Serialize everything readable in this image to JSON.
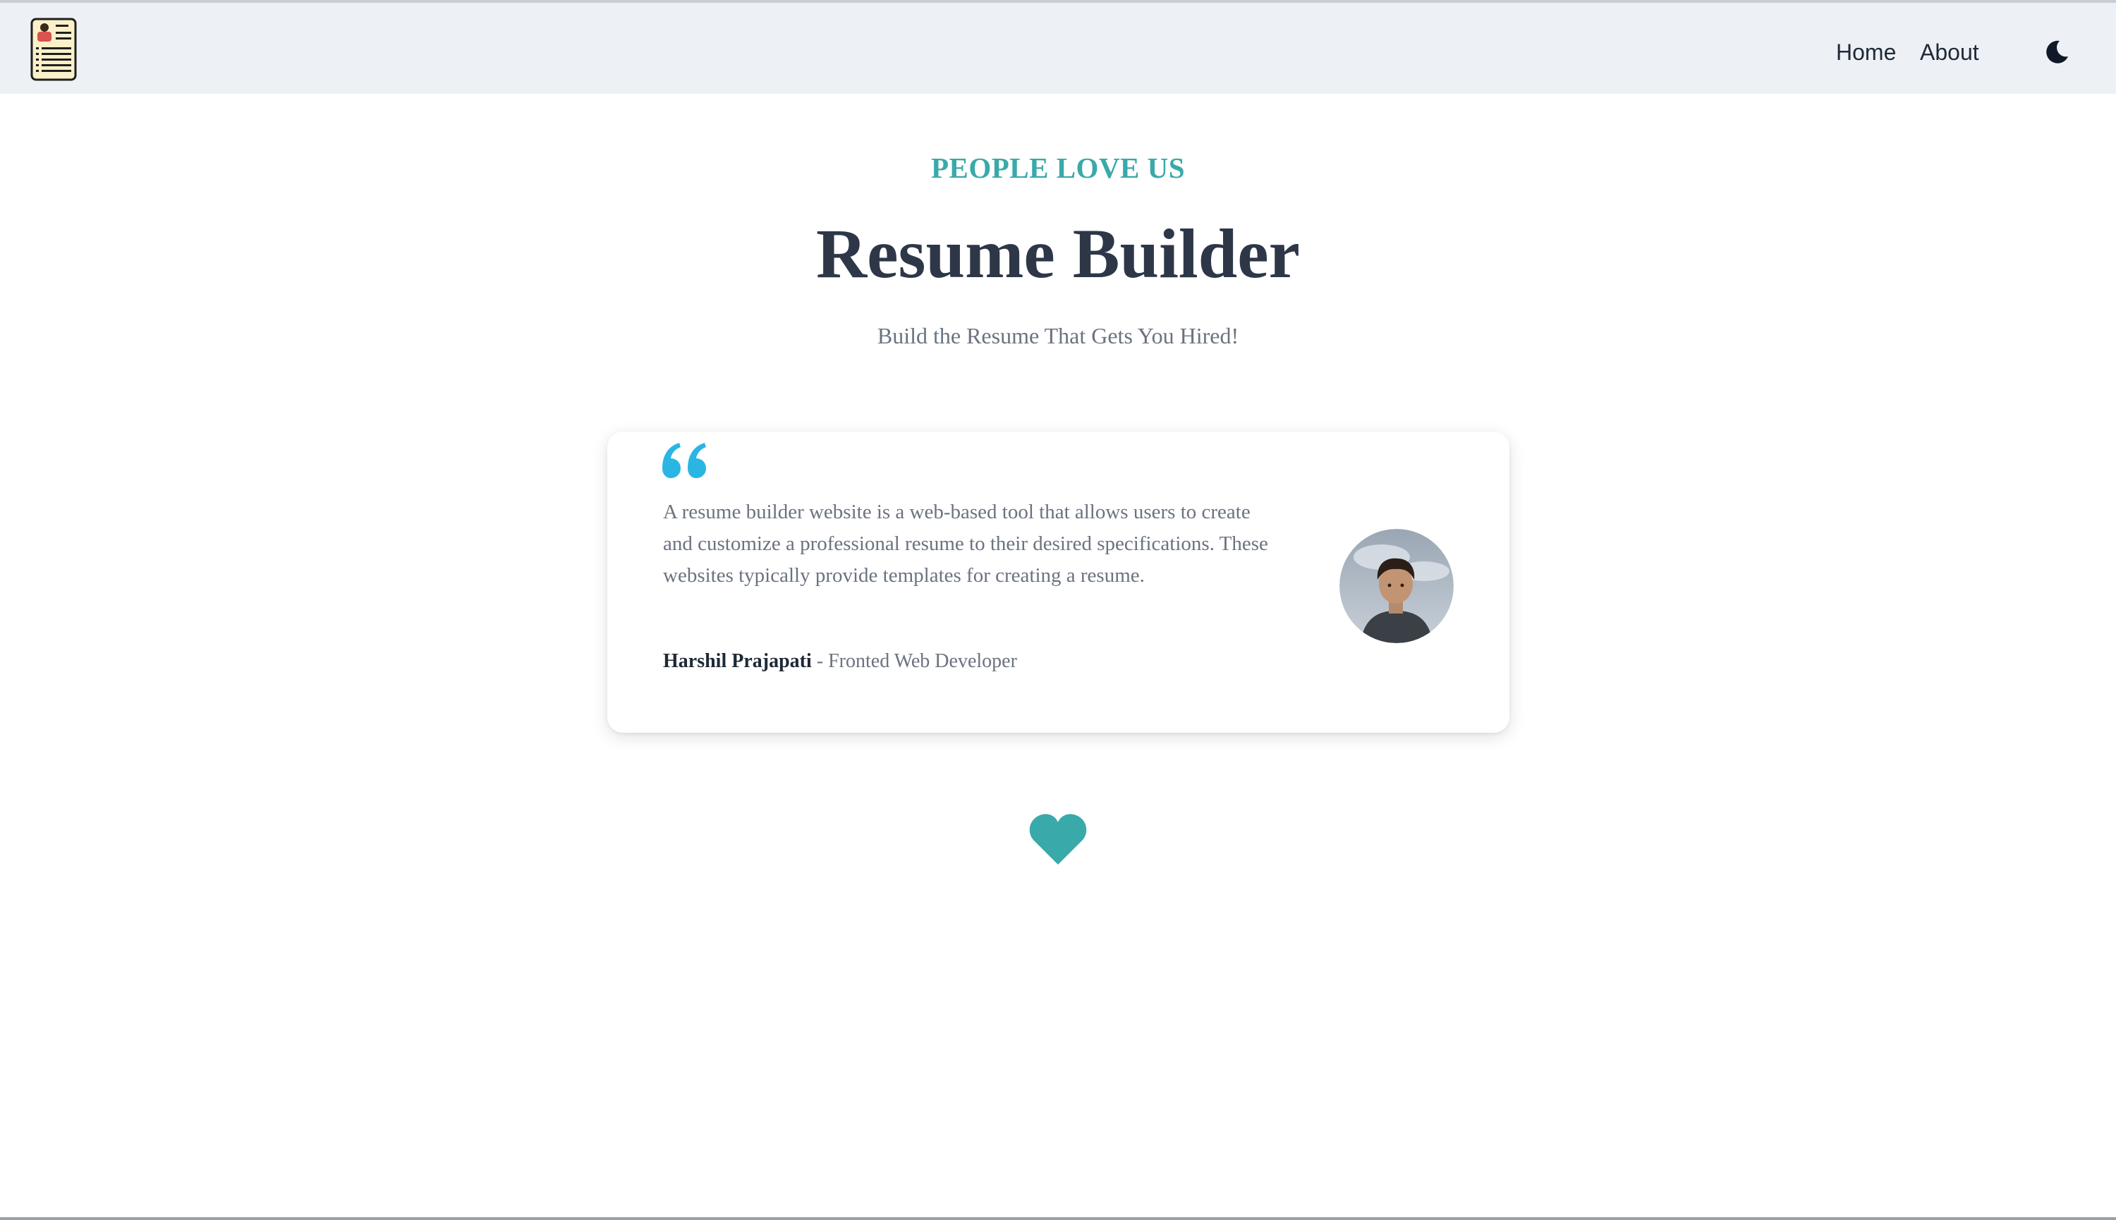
{
  "nav": {
    "logo_icon": "resume-document-icon",
    "home_label": "Home",
    "about_label": "About",
    "theme_icon": "moon-icon"
  },
  "hero": {
    "eyebrow": "PEOPLE LOVE US",
    "title": "Resume Builder",
    "subtitle": "Build the Resume That Gets You Hired!"
  },
  "testimonial": {
    "quote_icon": "quote-icon",
    "text": "A resume builder website is a web-based tool that allows users to create and customize a professional resume to their desired specifications. These websites typically provide templates for creating a resume.",
    "author_name": "Harshil Prajapati",
    "author_role": " - Fronted Web Developer",
    "avatar_icon": "avatar-photo"
  },
  "footer_icon": "heart-icon",
  "colors": {
    "accent": "#3aa9a9",
    "quote": "#29b6e3",
    "title": "#2d3748",
    "muted": "#6b7280",
    "navbar_bg": "#edf1f5"
  }
}
